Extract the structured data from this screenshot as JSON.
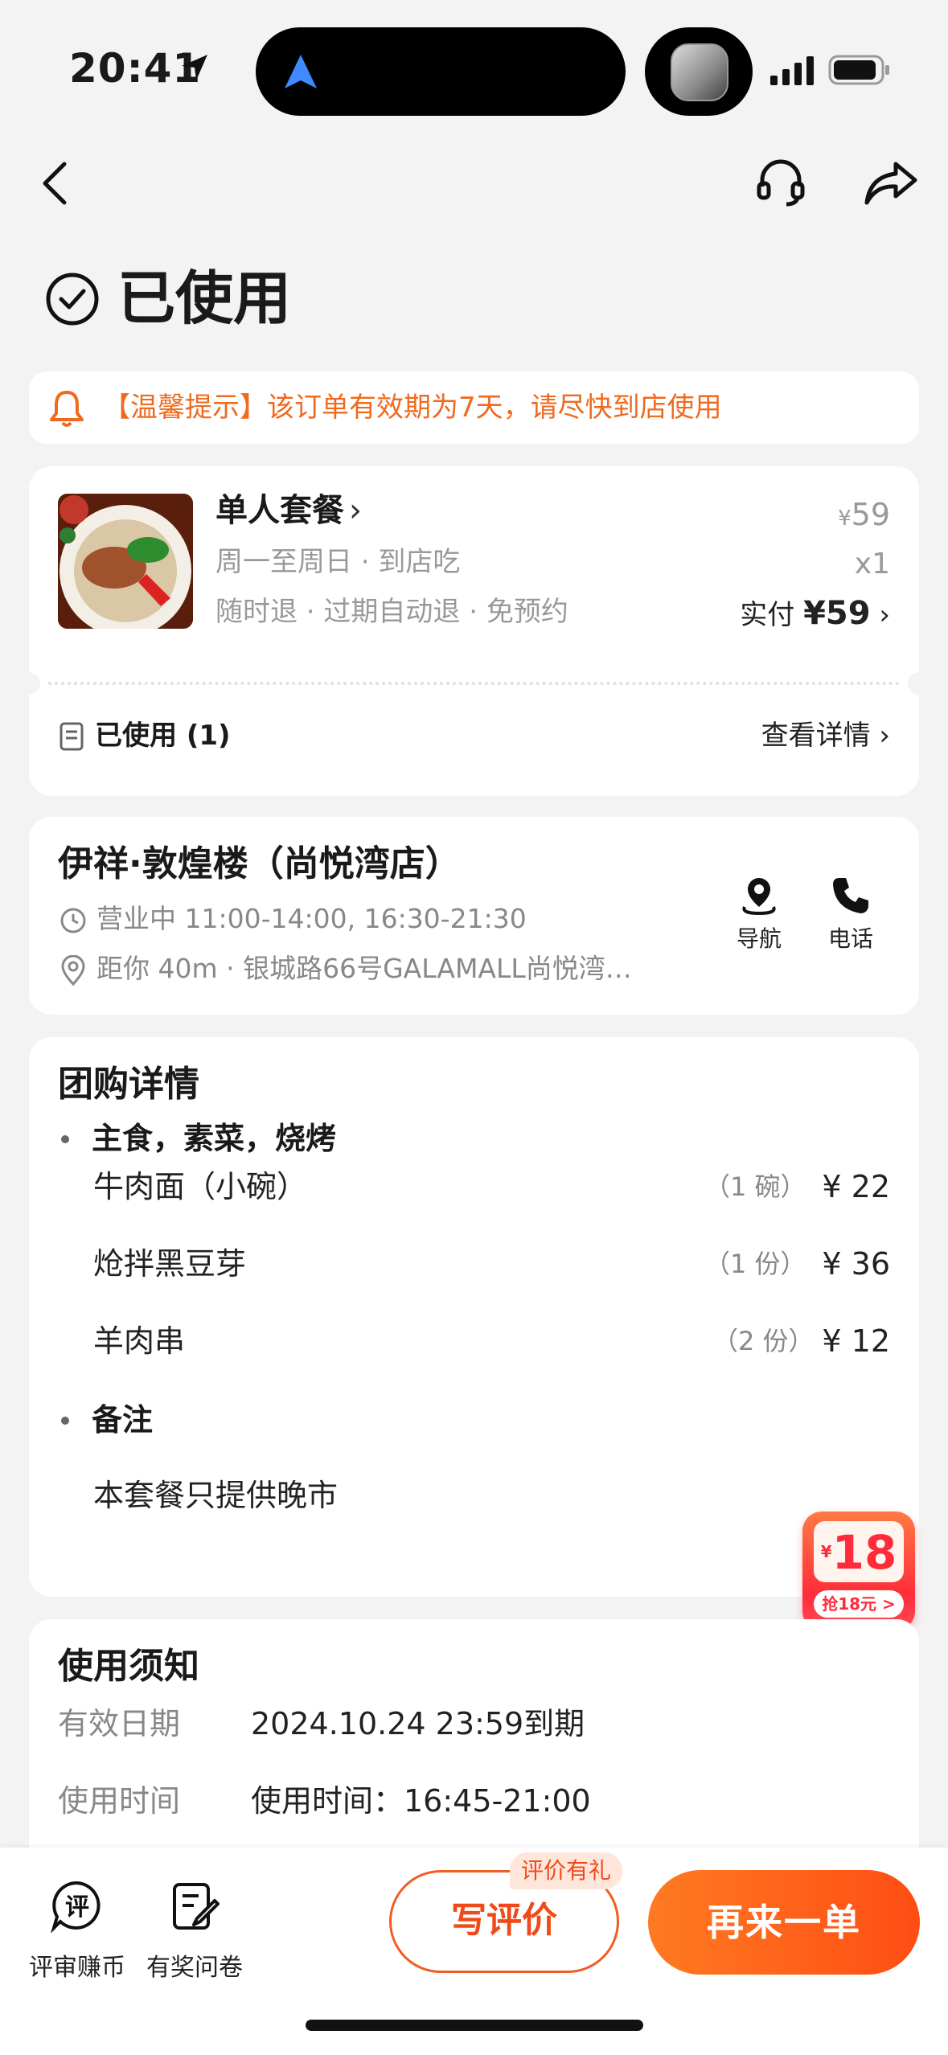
{
  "status_bar": {
    "time": "20:41"
  },
  "header": {
    "status_title": "已使用"
  },
  "tip": {
    "text": "【温馨提示】该订单有效期为7天，请尽快到店使用"
  },
  "order": {
    "product_name": "单人套餐",
    "subtitle1": "周一至周日 · 到店吃",
    "subtitle2": "随时退 · 过期自动退 · 免预约",
    "currency": "¥",
    "original_price": "59",
    "quantity": "x1",
    "paid_label": "实付",
    "paid_amount": "¥59",
    "used_text": "已使用 (1)",
    "detail_link": "查看详情"
  },
  "shop": {
    "name": "伊祥·敦煌楼（尚悦湾店）",
    "hours": "营业中 11:00-14:00, 16:30-21:30",
    "address": "距你 40m · 银城路66号GALAMALL尚悦湾…",
    "nav_label": "导航",
    "call_label": "电话"
  },
  "details": {
    "title": "团购详情",
    "group1_title": "主食，素菜，烧烤",
    "items": [
      {
        "name": "牛肉面（小碗）",
        "qty": "（1 碗）",
        "price": "¥ 22"
      },
      {
        "name": "炝拌黑豆芽",
        "qty": "（1 份）",
        "price": "¥ 36"
      },
      {
        "name": "羊肉串",
        "qty": "（2 份）",
        "price": "¥ 12"
      }
    ],
    "group2_title": "备注",
    "remark": "本套餐只提供晚市"
  },
  "red_packet": {
    "currency": "¥",
    "amount": "18",
    "button": "抢18元 >"
  },
  "notice": {
    "title": "使用须知",
    "rows": [
      {
        "label": "有效日期",
        "value": "2024.10.24 23:59到期"
      },
      {
        "label": "使用时间",
        "value": "使用时间：16:45-21:00"
      }
    ]
  },
  "bottom": {
    "review_coin": "评审赚币",
    "survey": "有奖问卷",
    "write_review": "写评价",
    "write_badge": "评价有礼",
    "reorder": "再来一单"
  },
  "colors": {
    "accent": "#f25c22",
    "tip_text": "#f06a1e",
    "red": "#ff2b3a"
  }
}
